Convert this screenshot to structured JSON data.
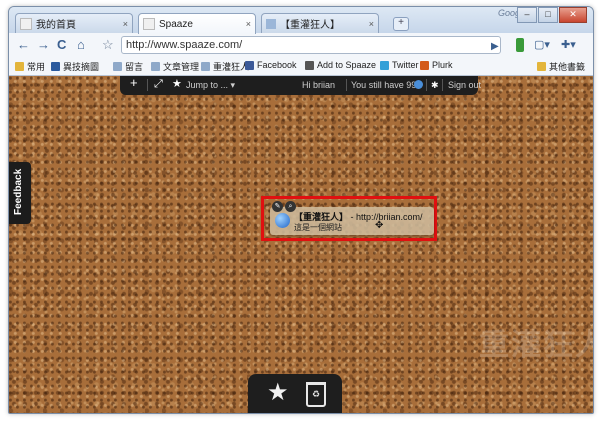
{
  "tabs": [
    {
      "label": "我的首頁",
      "close": "×"
    },
    {
      "label": "Spaaze",
      "close": "×"
    },
    {
      "label": "【重灌狂人】",
      "close": "×"
    }
  ],
  "new_tab_label": "+",
  "google_label": "Google",
  "window_controls": {
    "minimize": "–",
    "maximize": "□",
    "close": "✕"
  },
  "toolbar": {
    "back": "←",
    "forward": "→",
    "reload": "C",
    "home": "⌂",
    "star": "☆",
    "url": "http://www.spaaze.com/",
    "go": "▶",
    "page": "▢▾",
    "wrench": "✚▾"
  },
  "bookmarks": [
    {
      "label": "常用",
      "color": "#e3b53b"
    },
    {
      "label": "異技摘圖",
      "color": "#2b5a9e"
    },
    {
      "label": "留言",
      "color": "#8fa9c9"
    },
    {
      "label": "文章管理",
      "color": "#8fa9c9"
    },
    {
      "label": "重灌狂人",
      "color": "#8fa9c9"
    },
    {
      "label": "Facebook",
      "color": "#3b5998"
    },
    {
      "label": "Add to Spaaze",
      "color": "#555555"
    },
    {
      "label": "Twitter",
      "color": "#33a0d8"
    },
    {
      "label": "Plurk",
      "color": "#d35a1a"
    },
    {
      "label": "其他書籤",
      "color": "#e3b53b"
    }
  ],
  "spaaze_bar": {
    "plus": "+",
    "fit": "⤢",
    "jump": "Jump to ...",
    "greeting": "Hi briian",
    "credits": "You still have 995",
    "signout": "Sign out"
  },
  "feedback": "Feedback",
  "note": {
    "title_bold": "【重灌狂人】",
    "title_rest": " - http://briian.com/",
    "subtitle": "這是一個網站"
  },
  "watermark": "重灌狂人",
  "colors": {
    "highlight": "#e01010",
    "cork": "#a86e3a",
    "bar": "#1e1e1e"
  }
}
